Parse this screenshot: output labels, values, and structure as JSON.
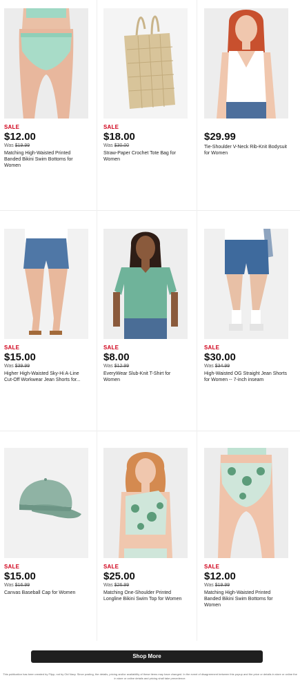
{
  "products": [
    {
      "sale": "SALE",
      "price": "$12.00",
      "was_prefix": "Was",
      "was_price": "$19.99",
      "name": "Matching High-Waisted Printed Banded Bikini Swim Bottoms for Women"
    },
    {
      "sale": "SALE",
      "price": "$18.00",
      "was_prefix": "Was",
      "was_price": "$30.00",
      "name": "Straw-Paper Crochet Tote Bag for Women"
    },
    {
      "sale": "",
      "price": "$29.99",
      "was_prefix": "",
      "was_price": "",
      "name": "Tie-Shoulder V-Neck Rib-Knit Bodysuit for Women"
    },
    {
      "sale": "SALE",
      "price": "$15.00",
      "was_prefix": "Was",
      "was_price": "$39.99",
      "name": "Higher High-Waisted Sky-Hi A-Line Cut-Off Workwear Jean Shorts for..."
    },
    {
      "sale": "SALE",
      "price": "$8.00",
      "was_prefix": "Was",
      "was_price": "$12.99",
      "name": "EveryWear Slub-Knit T-Shirt for Women"
    },
    {
      "sale": "SALE",
      "price": "$30.00",
      "was_prefix": "Was",
      "was_price": "$34.99",
      "name": "High-Waisted OG Straight Jean Shorts for Women -- 7-inch inseam"
    },
    {
      "sale": "SALE",
      "price": "$15.00",
      "was_prefix": "Was",
      "was_price": "$16.99",
      "name": "Canvas Baseball Cap for Women"
    },
    {
      "sale": "SALE",
      "price": "$25.00",
      "was_prefix": "Was",
      "was_price": "$26.99",
      "name": "Matching One-Shoulder Printed Longline Bikini Swim Top for Women"
    },
    {
      "sale": "SALE",
      "price": "$12.00",
      "was_prefix": "Was",
      "was_price": "$19.99",
      "name": "Matching High-Waisted Printed Banded Bikini Swim Bottoms for Women"
    }
  ],
  "shop_more_label": "Shop More",
  "footer_text": "This publication has been created by Flipp, not by Old Navy. Since posting, the details, pricing and/or availability of these items may have changed. In the event of disagreement between this popup and the price or details in store or online the in store or online details and pricing shall take precedence.",
  "colors": {
    "sale_red": "#d0021b",
    "button_bg": "#1f1f1f"
  },
  "images": [
    "bikini-bottom-mint",
    "straw-tote-bag",
    "white-bodysuit-model",
    "denim-shorts-model",
    "green-tshirt-model",
    "long-denim-shorts-model",
    "green-baseball-cap",
    "palm-print-bikini-top-model",
    "palm-print-bikini-bottom"
  ]
}
